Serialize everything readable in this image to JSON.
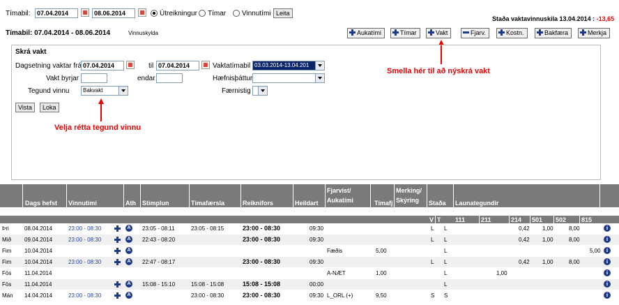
{
  "top": {
    "period_label": "Tímabil:",
    "date_from": "07.04.2014",
    "date_to": "08.06.2014",
    "radio_options": [
      "Útreikningur",
      "Tímar",
      "Vinnutími"
    ],
    "search_label": "Leita",
    "status_text": "Staða vaktavinnuskila 13.04.2014 :",
    "status_value": "-13,65"
  },
  "subheader": {
    "title": "Tímabil: 07.04.2014 - 08.06.2014",
    "subtitle": "Vinnuskylda"
  },
  "toolbar": [
    {
      "label": "Aukatími",
      "icon": "plus-icon"
    },
    {
      "label": "Tímar",
      "icon": "plus-icon"
    },
    {
      "label": "Vakt",
      "icon": "plus-icon"
    },
    {
      "label": "Fjarv.",
      "icon": "minus-icon"
    },
    {
      "label": "Kostn.",
      "icon": "plus-icon"
    },
    {
      "label": "Bakfæra",
      "icon": "plus-icon"
    },
    {
      "label": "Merkja",
      "icon": "plus-icon"
    }
  ],
  "form": {
    "title": "Skrá vakt",
    "date_label": "Dagsetning vaktar frá",
    "date_from": "07.04.2014",
    "to_label": "til",
    "date_to": "07.04.2014",
    "period_label": "Vaktatímabil",
    "period_value": "03.03.2014-13.04.201",
    "start_label": "Vakt byrjar",
    "start_value": "",
    "end_label": "endar",
    "end_value": "",
    "skill_label": "Hæfnisþáttur",
    "skill_value": "",
    "worktype_label": "Tegund vinnu",
    "worktype_value": "Bakvakt",
    "level_label": "Færnistig",
    "level_value": "",
    "save_label": "Vista",
    "close_label": "Loka"
  },
  "annotations": {
    "new_shift": "Smella hér til að nýskrá vakt",
    "choose_type": "Velja rétta tegund vinnu"
  },
  "table": {
    "headers": {
      "date": "Dags hefst",
      "worktime": "Vinnutími",
      "ath": "Ath",
      "punch": "Stimplun",
      "time_entry": "Tímafærsla",
      "calc": "Reiknifors",
      "total": "Heildart",
      "absence": "Fjarvist/ Aukatími",
      "hourly": "Tímafj",
      "marking": "Merking/ Skýring",
      "status": "Staða",
      "paytypes": "Launategundir"
    },
    "subheaders": {
      "v": "V",
      "t": "T",
      "c111": "111",
      "c211": "211",
      "c214": "214",
      "c501": "501",
      "c502": "502",
      "c815": "815"
    },
    "rows": [
      {
        "day": "Þri",
        "date": "08.04.2014",
        "work": "23:00 - 08:30",
        "punch": "23:05 - 08:11",
        "entry": "23:05 - 08:15",
        "calc": "23:00 - 08:30",
        "total": "09:30",
        "absence": "",
        "hourly": "",
        "status_v": "L",
        "status_t": "L",
        "p211": "",
        "p214": "0,42",
        "p501": "1,00",
        "p502": "8,00",
        "p815": "",
        "icons": true
      },
      {
        "day": "Mið",
        "date": "09.04.2014",
        "work": "23:00 - 08:30",
        "punch": "22:43 - 08:20",
        "entry": "",
        "calc": "23:00 - 08:30",
        "total": "09:30",
        "absence": "",
        "hourly": "",
        "status_v": "L",
        "status_t": "L",
        "p211": "",
        "p214": "0,42",
        "p501": "1,00",
        "p502": "8,00",
        "p815": "",
        "icons": true
      },
      {
        "day": "Fim",
        "date": "10.04.2014",
        "work": "",
        "punch": "",
        "entry": "",
        "calc": "",
        "total": "",
        "absence": "Fæðis",
        "hourly": "5,00",
        "status_v": "",
        "status_t": "L",
        "p211": "",
        "p214": "",
        "p501": "",
        "p502": "",
        "p815": "5,00",
        "icons": true
      },
      {
        "day": "Fim",
        "date": "10.04.2014",
        "work": "23:00 - 08:30",
        "punch": "22:47 - 08:17",
        "entry": "",
        "calc": "23:00 - 08:30",
        "total": "09:30",
        "absence": "",
        "hourly": "",
        "status_v": "L",
        "status_t": "L",
        "p211": "",
        "p214": "0,42",
        "p501": "1,00",
        "p502": "8,00",
        "p815": "",
        "icons": true
      },
      {
        "day": "Fös",
        "date": "11.04.2014",
        "work": "",
        "punch": "",
        "entry": "",
        "calc": "",
        "total": "",
        "absence": "A-NÆT",
        "hourly": "1,00",
        "status_v": "",
        "status_t": "L",
        "p211": "1,00",
        "p214": "",
        "p501": "",
        "p502": "",
        "p815": "",
        "icons": false
      },
      {
        "day": "Fös",
        "date": "11.04.2014",
        "work": "",
        "punch": "15:08 - 15:10",
        "entry": "15:08 - 15:08",
        "calc": "15:08 - 15:08",
        "total": "00:00",
        "absence": "",
        "hourly": "",
        "status_v": "",
        "status_t": "L",
        "p211": "",
        "p214": "",
        "p501": "",
        "p502": "",
        "p815": "",
        "icons": true
      },
      {
        "day": "Mán",
        "date": "14.04.2014",
        "work": "23:00 - 08:30",
        "punch": "",
        "entry": "23:00 - 08:30",
        "calc": "23:00 - 08:30",
        "total": "09:30",
        "absence": "L_ORL (+)",
        "hourly": "9,50",
        "status_v": "S",
        "status_t": "S",
        "p211": "",
        "p214": "",
        "p501": "",
        "p502": "",
        "p815": "",
        "icons": true
      }
    ]
  },
  "colors": {
    "header_bg": "#7a7a7a",
    "accent_red": "#e00000",
    "link_blue": "#1f3fa0",
    "row_alt": "#f0f0f0"
  }
}
